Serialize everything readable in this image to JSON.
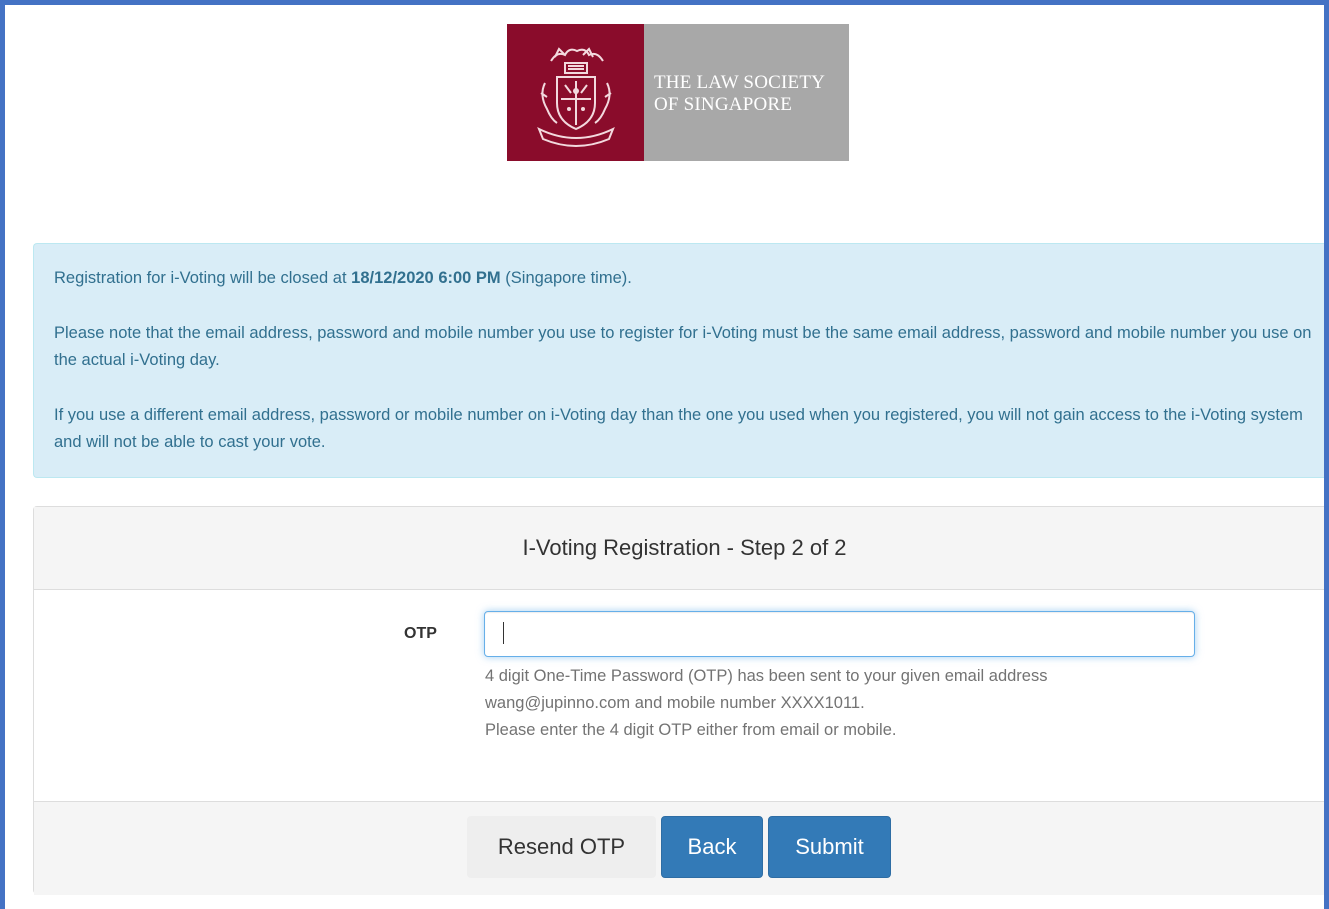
{
  "logo": {
    "line1": "THE LAW SOCIETY",
    "line2": "OF SINGAPORE",
    "crest_color": "#8a0c2b",
    "text_bg_color": "#a8a8a8"
  },
  "alert": {
    "line1_prefix": "Registration for i-Voting will be closed at ",
    "line1_deadline": "18/12/2020 6:00 PM",
    "line1_suffix": " (Singapore time).",
    "para2": "Please note that the email address, password and mobile number you use to register for i-Voting must be the same email address, password and mobile number you use on the actual i-Voting day.",
    "para3": "If you use a different email address, password or mobile number on i-Voting day than the one you used when you registered, you will not gain access to the i-Voting system and will not be able to cast your vote."
  },
  "panel": {
    "title": "I-Voting Registration - Step 2 of 2"
  },
  "otp": {
    "label": "OTP",
    "value": "",
    "help_line1": "4 digit One-Time Password (OTP) has been sent to your given email address",
    "help_line2": "wang@jupinno.com and mobile number XXXX1011.",
    "help_line3": "Please enter the 4 digit OTP either from email or mobile."
  },
  "buttons": {
    "resend": "Resend OTP",
    "back": "Back",
    "submit": "Submit"
  },
  "colors": {
    "frame_border": "#4472c4",
    "alert_bg": "#d9edf7",
    "alert_text": "#31708f",
    "primary": "#337ab7"
  }
}
